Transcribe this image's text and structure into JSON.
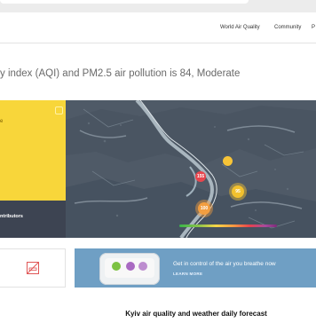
{
  "nav": {
    "links": [
      "World Air Quality",
      "Community",
      "P"
    ]
  },
  "headline": "y index (AQI) and PM2.5 air pollution is 84, Moderate",
  "aqi_panel": {
    "status_fragment": "e",
    "contributors_label": "ntributors",
    "color": "#f8d63a"
  },
  "map": {
    "markers": [
      {
        "value": "",
        "color": "#f7c437"
      },
      {
        "value": "155",
        "color": "#e8454d"
      },
      {
        "value": "95",
        "color": "#f2c12e"
      },
      {
        "value": "100",
        "color": "#f39e40"
      }
    ]
  },
  "promo": {
    "title": "Get in control of the air you breathe now",
    "cta": "LEARN MORE",
    "bg_color": "#6f9fc4"
  },
  "forecast": {
    "title": "Kyiv air quality and weather daily forecast"
  }
}
